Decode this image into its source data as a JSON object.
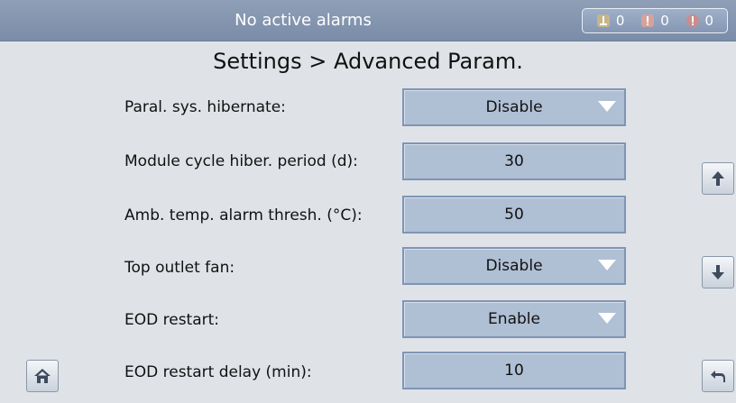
{
  "status_bar": {
    "message": "No active alarms",
    "alarm_counts": {
      "minor": "0",
      "major": "0",
      "critical": "0"
    },
    "icons": [
      "minor-alarm-icon",
      "major-alarm-icon",
      "critical-alarm-icon"
    ]
  },
  "page": {
    "title": "Settings > Advanced Param."
  },
  "params": [
    {
      "label": "Paral. sys. hibernate:",
      "value": "Disable",
      "type": "dropdown"
    },
    {
      "label": "Module cycle hiber. period (d):",
      "value": "30",
      "type": "input"
    },
    {
      "label": "Amb. temp. alarm thresh. (°C):",
      "value": "50",
      "type": "input"
    },
    {
      "label": "Top outlet fan:",
      "value": "Disable",
      "type": "dropdown"
    },
    {
      "label": "EOD restart:",
      "value": "Enable",
      "type": "dropdown"
    },
    {
      "label": "EOD restart delay (min):",
      "value": "10",
      "type": "input"
    }
  ],
  "navigation": {
    "icons": [
      "scroll-up-icon",
      "scroll-down-icon",
      "home-icon",
      "back-icon"
    ]
  },
  "colors": {
    "topbar": "#8696b0",
    "field_bg": "#afbfd4",
    "field_border": "#7f95b4",
    "page_bg": "#dfe3e7"
  }
}
